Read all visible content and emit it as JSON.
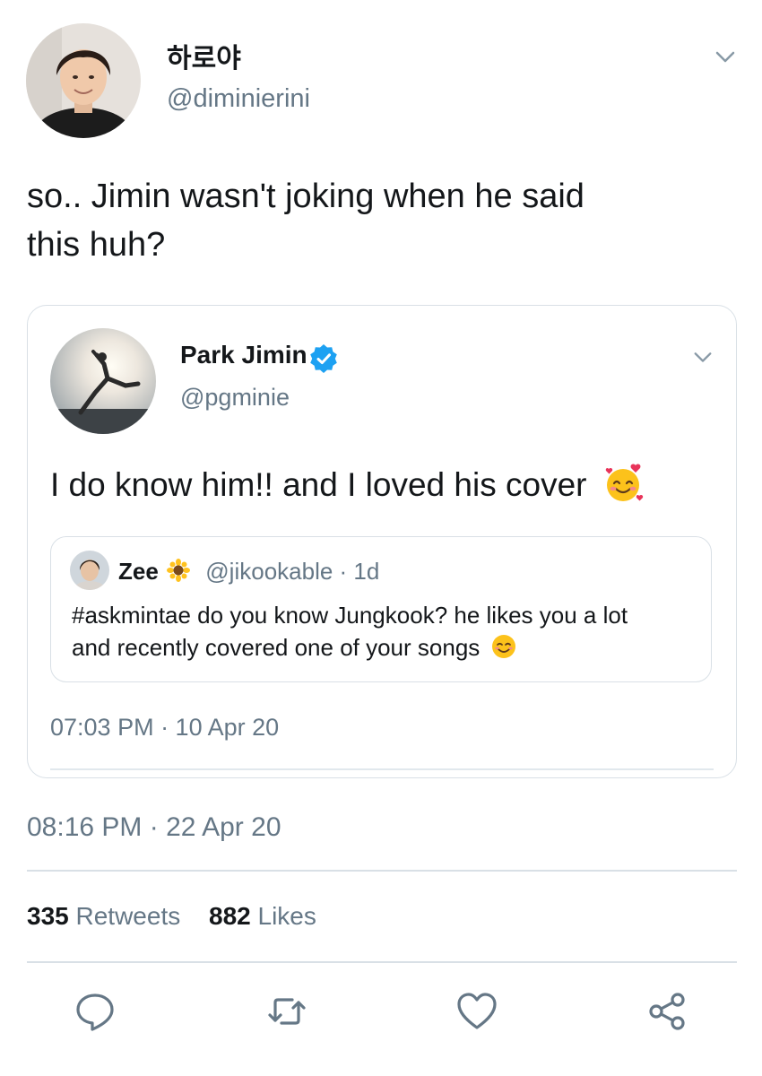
{
  "tweet": {
    "author": {
      "name": "하로야",
      "handle": "@diminierini"
    },
    "text_line1": "so.. Jimin wasn't joking when he said",
    "text_line2": "this huh?",
    "time": "08:16 PM · 22 Apr 20",
    "stats": {
      "retweets_count": "335",
      "retweets_label": "Retweets",
      "likes_count": "882",
      "likes_label": "Likes"
    }
  },
  "quoted": {
    "author": {
      "name": "Park Jimin",
      "handle": "@pgminie",
      "verified": true
    },
    "text": "I do know him!! and I loved his cover",
    "emoji": "smiling-face-with-hearts",
    "time": "07:03 PM · 10 Apr 20",
    "nested": {
      "author": {
        "name": "Zee",
        "name_emoji": "sunflower",
        "handle": "@jikookable",
        "age": "· 1d"
      },
      "text_line1": "#askmintae do you know Jungkook? he likes you a lot",
      "text_line2": "and recently covered one of your songs",
      "emoji": "smiling-face"
    }
  },
  "actions": [
    "reply-icon",
    "retweet-icon",
    "like-icon",
    "share-icon"
  ],
  "colors": {
    "text": "#14171a",
    "secondary": "#657786",
    "border": "#d9e0e6",
    "verified": "#1da1f2"
  }
}
